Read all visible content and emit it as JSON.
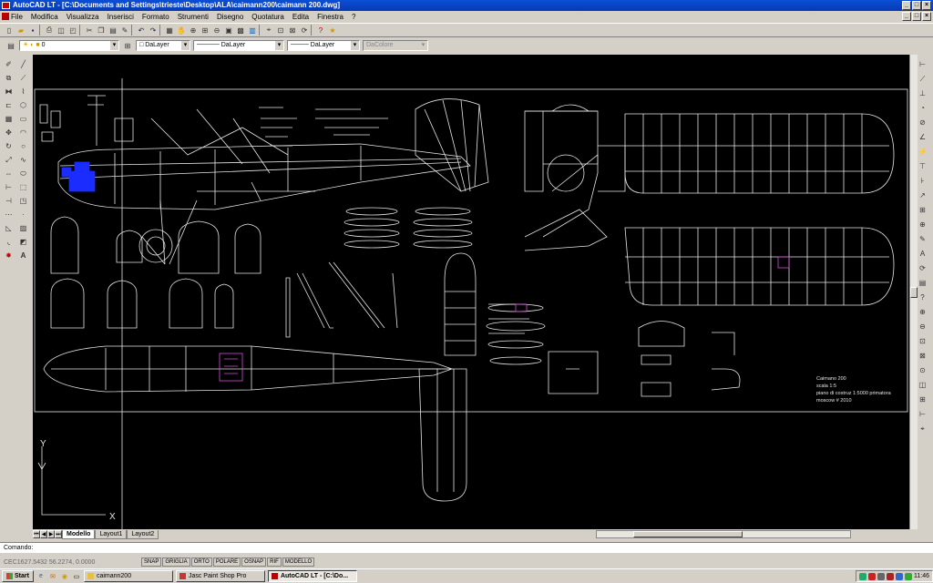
{
  "window": {
    "title": "AutoCAD LT - [C:\\Documents and Settings\\trieste\\Desktop\\ALA\\caimann200\\caimann 200.dwg]",
    "controls": [
      "_",
      "□",
      "×"
    ]
  },
  "menu": {
    "items": [
      "File",
      "Modifica",
      "Visualizza",
      "Inserisci",
      "Formato",
      "Strumenti",
      "Disegno",
      "Quotatura",
      "Edita",
      "Finestra",
      "?"
    ]
  },
  "properties_toolbar": {
    "layer": "0",
    "color": "DaLayer",
    "linetype": "DaLayer",
    "lineweight": "DaLayer",
    "plotstyle": "DaColore"
  },
  "layout_tabs": [
    "Modello",
    "Layout1",
    "Layout2"
  ],
  "drawing": {
    "title_block_lines": [
      "Caimano 200",
      "scala 1:5",
      "piano di costruz 1:5000 primatora",
      "moscow      # 2010"
    ],
    "ucs": {
      "x_label": "X",
      "y_label": "Y"
    }
  },
  "command_line": {
    "text": "Comando:"
  },
  "status": {
    "coordinates": "CEC1627.5432 56.2274, 0.0000",
    "toggles": [
      "SNAP",
      "GRIGLIA",
      "ORTO",
      "POLARE",
      "OSNAP",
      "RIF",
      "MODELLO"
    ]
  },
  "taskbar": {
    "start_label": "Start",
    "tasks": [
      {
        "label": "caimann200",
        "active": false
      },
      {
        "label": "Jasc Paint Shop Pro",
        "active": false
      },
      {
        "label": "AutoCAD LT - [C:\\Do...",
        "active": true
      }
    ],
    "clock": "11:46"
  },
  "colors": {
    "canvas": "#000000",
    "lines": "#e6e6e6",
    "engine": "#1a2cff",
    "highlight": "#d84bd8",
    "titlebar": "#0839b3"
  }
}
